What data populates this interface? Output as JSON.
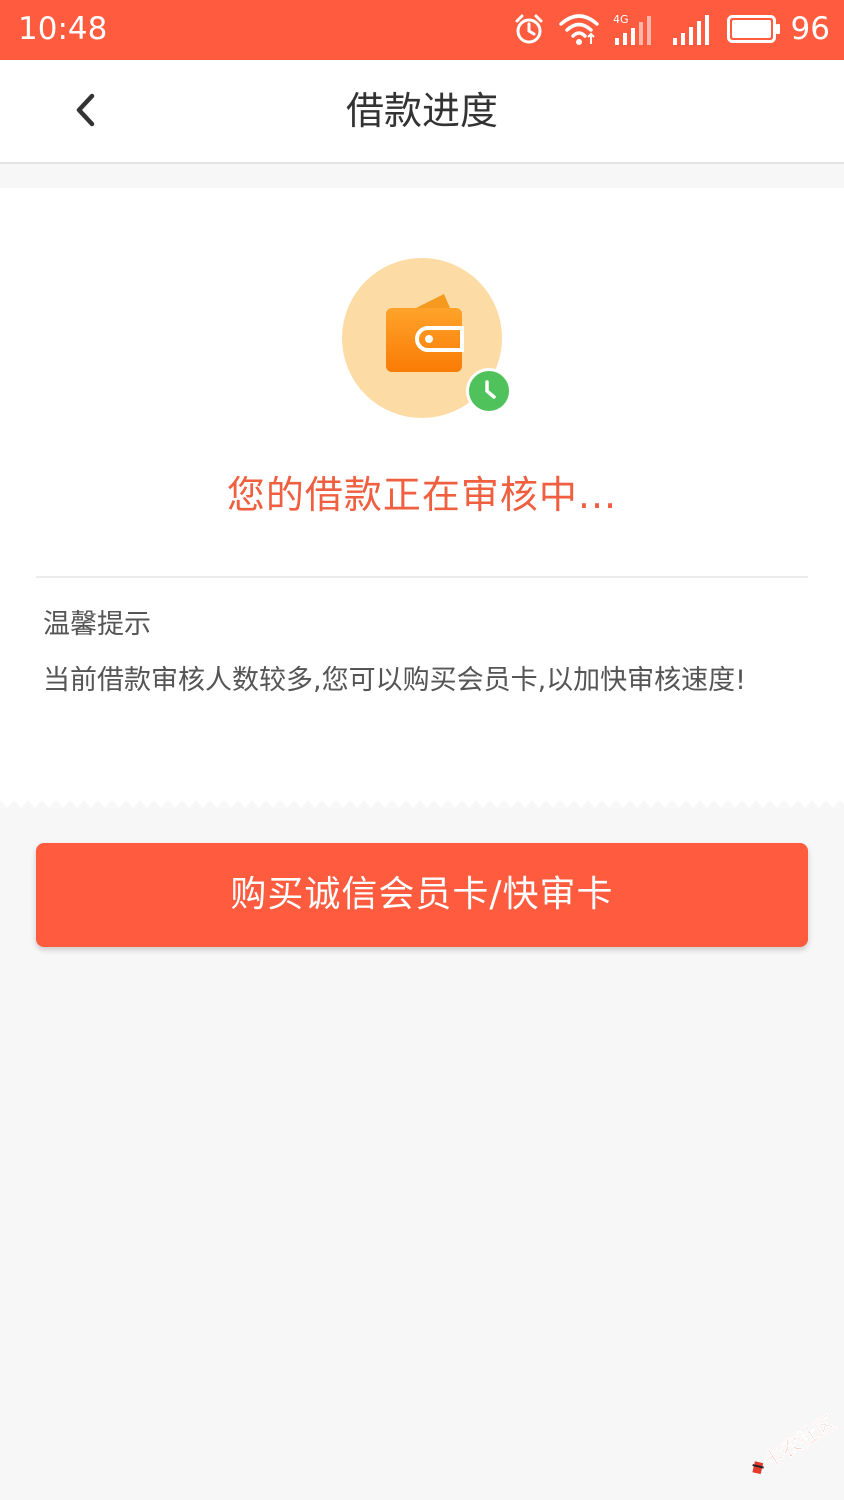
{
  "status_bar": {
    "time": "10:48",
    "battery_level": "96",
    "icons": [
      "alarm-icon",
      "wifi-icon",
      "signal-4g-icon",
      "signal-icon",
      "battery-icon"
    ]
  },
  "header": {
    "title": "借款进度",
    "back_icon": "chevron-left-icon"
  },
  "status": {
    "icon": "wallet-icon",
    "badge_icon": "clock-icon",
    "message": "您的借款正在审核中..."
  },
  "tips": {
    "title": "温馨提示",
    "body": "当前借款审核人数较多,您可以购买会员卡,以加快审核速度!"
  },
  "cta": {
    "label": "购买诚信会员卡/快审卡"
  },
  "watermark": {
    "text": "卡农社区"
  },
  "colors": {
    "accent": "#fe5b3f",
    "message": "#ef5f40",
    "wallet_bg": "#fddba4",
    "wallet": "#fb8c12",
    "badge": "#4fc25b"
  }
}
